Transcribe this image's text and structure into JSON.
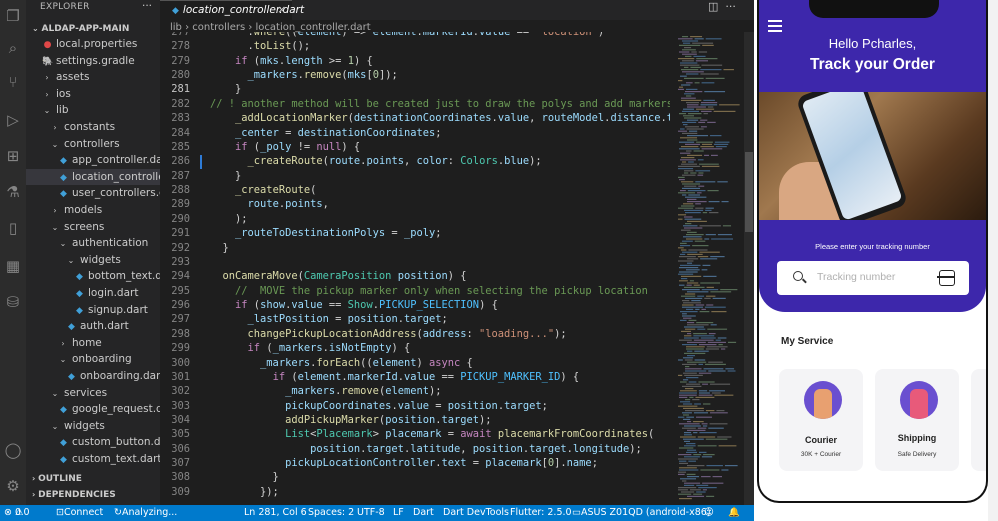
{
  "sidebar": {
    "explorer_title": "EXPLORER",
    "project": "ALDAP-APP-MAIN",
    "tree": [
      {
        "label": "local.properties",
        "depth": 1,
        "icon": "red"
      },
      {
        "label": "settings.gradle",
        "depth": 1,
        "icon": "gradle"
      },
      {
        "label": "assets",
        "depth": 1,
        "folder": "closed"
      },
      {
        "label": "ios",
        "depth": 1,
        "folder": "closed"
      },
      {
        "label": "lib",
        "depth": 1,
        "folder": "open"
      },
      {
        "label": "constants",
        "depth": 2,
        "folder": "closed"
      },
      {
        "label": "controllers",
        "depth": 2,
        "folder": "open"
      },
      {
        "label": "app_controller.dart",
        "depth": 3,
        "icon": "dart"
      },
      {
        "label": "location_controller...",
        "depth": 3,
        "icon": "dart",
        "selected": true
      },
      {
        "label": "user_controllers.dart",
        "depth": 3,
        "icon": "dart"
      },
      {
        "label": "models",
        "depth": 2,
        "folder": "closed"
      },
      {
        "label": "screens",
        "depth": 2,
        "folder": "open"
      },
      {
        "label": "authentication",
        "depth": 3,
        "folder": "open"
      },
      {
        "label": "widgets",
        "depth": 4,
        "folder": "open"
      },
      {
        "label": "bottom_text.dart",
        "depth": 5,
        "icon": "dart"
      },
      {
        "label": "login.dart",
        "depth": 5,
        "icon": "dart"
      },
      {
        "label": "signup.dart",
        "depth": 5,
        "icon": "dart"
      },
      {
        "label": "auth.dart",
        "depth": 4,
        "icon": "dart"
      },
      {
        "label": "home",
        "depth": 3,
        "folder": "closed"
      },
      {
        "label": "onboarding",
        "depth": 3,
        "folder": "open"
      },
      {
        "label": "onboarding.dart",
        "depth": 4,
        "icon": "dart"
      },
      {
        "label": "services",
        "depth": 2,
        "folder": "open"
      },
      {
        "label": "google_request.dart",
        "depth": 3,
        "icon": "dart"
      },
      {
        "label": "widgets",
        "depth": 2,
        "folder": "open"
      },
      {
        "label": "custom_button.dart",
        "depth": 3,
        "icon": "dart"
      },
      {
        "label": "custom_text.dart",
        "depth": 3,
        "icon": "dart"
      }
    ],
    "outline": "OUTLINE",
    "dependencies": "DEPENDENCIES"
  },
  "editor": {
    "tab_label": "location_controller.dart",
    "breadcrumb": "lib › controllers › location_controller.dart",
    "current_line": 281,
    "lines": [
      {
        "n": 277,
        "html": "      .<span class='f'>where</span>((<span class='v'>element</span>) => <span class='v'>element</span>.<span class='v'>markerId</span>.<span class='v'>value</span> == <span class='s'>\"location\"</span>)"
      },
      {
        "n": 278,
        "html": "      .<span class='f'>toList</span>();"
      },
      {
        "n": 279,
        "html": "    <span class='k'>if</span> (<span class='v'>mks</span>.<span class='v'>length</span> >= <span class='n'>1</span>) {"
      },
      {
        "n": 280,
        "html": "      <span class='v'>_markers</span>.<span class='f'>remove</span>(<span class='v'>mks</span>[<span class='n'>0</span>]);"
      },
      {
        "n": 281,
        "html": "    }"
      },
      {
        "n": 282,
        "html": "<span class='c'>// ! another method will be created just to draw the polys and add markers</span>"
      },
      {
        "n": 283,
        "html": "    <span class='f'>_addLocationMarker</span>(<span class='v'>destinationCoordinates</span>.<span class='v'>value</span>, <span class='v'>routeModel</span>.<span class='v'>distance</span>.<span class='v'>text</span>);"
      },
      {
        "n": 284,
        "html": "    <span class='v'>_center</span> = <span class='v'>destinationCoordinates</span>;"
      },
      {
        "n": 285,
        "html": "    <span class='k'>if</span> (<span class='v'>_poly</span> != <span class='k'>null</span>) {"
      },
      {
        "n": 286,
        "html": "      <span class='f'>_createRoute</span>(<span class='v'>route</span>.<span class='v'>points</span>, <span class='v'>color</span>: <span class='t'>Colors</span>.<span class='v'>blue</span>);"
      },
      {
        "n": 287,
        "html": "    }"
      },
      {
        "n": 288,
        "html": "    <span class='f'>_createRoute</span>("
      },
      {
        "n": 289,
        "html": "      <span class='v'>route</span>.<span class='v'>points</span>,"
      },
      {
        "n": 290,
        "html": "    );"
      },
      {
        "n": 291,
        "html": "    <span class='v'>_routeToDestinationPolys</span> = <span class='v'>_poly</span>;"
      },
      {
        "n": 292,
        "html": "  }"
      },
      {
        "n": 293,
        "html": ""
      },
      {
        "n": 294,
        "html": "  <span class='f'>onCameraMove</span>(<span class='t'>CameraPosition</span> <span class='v'>position</span>) {"
      },
      {
        "n": 295,
        "html": "    <span class='c'>//  MOVE the pickup marker only when selecting the pickup location</span>"
      },
      {
        "n": 296,
        "html": "    <span class='k'>if</span> (<span class='v'>show</span>.<span class='v'>value</span> == <span class='t'>Show</span>.<span class='cst'>PICKUP_SELECTION</span>) {"
      },
      {
        "n": 297,
        "html": "      <span class='v'>_lastPosition</span> = <span class='v'>position</span>.<span class='v'>target</span>;"
      },
      {
        "n": 298,
        "html": "      <span class='f'>changePickupLocationAddress</span>(<span class='v'>address</span>: <span class='s'>\"loading...\"</span>);"
      },
      {
        "n": 299,
        "html": "      <span class='k'>if</span> (<span class='v'>_markers</span>.<span class='v'>isNotEmpty</span>) {"
      },
      {
        "n": 300,
        "html": "        <span class='v'>_markers</span>.<span class='f'>forEach</span>((<span class='v'>element</span>) <span class='k'>async</span> {"
      },
      {
        "n": 301,
        "html": "          <span class='k'>if</span> (<span class='v'>element</span>.<span class='v'>markerId</span>.<span class='v'>value</span> == <span class='cst'>PICKUP_MARKER_ID</span>) {"
      },
      {
        "n": 302,
        "html": "            <span class='v'>_markers</span>.<span class='f'>remove</span>(<span class='v'>element</span>);"
      },
      {
        "n": 303,
        "html": "            <span class='v'>pickupCoordinates</span>.<span class='v'>value</span> = <span class='v'>position</span>.<span class='v'>target</span>;"
      },
      {
        "n": 304,
        "html": "            <span class='f'>addPickupMarker</span>(<span class='v'>position</span>.<span class='v'>target</span>);"
      },
      {
        "n": 305,
        "html": "            <span class='t'>List</span>&lt;<span class='t'>Placemark</span>&gt; <span class='v'>placemark</span> = <span class='k'>await</span> <span class='f'>placemarkFromCoordinates</span>("
      },
      {
        "n": 306,
        "html": "                <span class='v'>position</span>.<span class='v'>target</span>.<span class='v'>latitude</span>, <span class='v'>position</span>.<span class='v'>target</span>.<span class='v'>longitude</span>);"
      },
      {
        "n": 307,
        "html": "            <span class='v'>pickupLocationController</span>.<span class='v'>text</span> = <span class='v'>placemark</span>[<span class='n'>0</span>].<span class='v'>name</span>;"
      },
      {
        "n": 308,
        "html": "          }"
      },
      {
        "n": 309,
        "html": "        });"
      }
    ]
  },
  "status": {
    "errors": "0",
    "warnings": "0",
    "connect": "Connect",
    "analyzing": "Analyzing...",
    "position": "Ln 281, Col 6",
    "spaces": "Spaces: 2",
    "encoding": "UTF-8",
    "eol": "LF",
    "language": "Dart",
    "devtools": "Dart DevTools",
    "flutter": "Flutter: 2.5.0",
    "device": "ASUS Z01QD (android-x86)"
  },
  "phone": {
    "greeting": "Hello Pcharles,",
    "headline": "Track your Order",
    "prompt": "Please enter your tracking number",
    "search_placeholder": "Tracking number",
    "section_title": "My Service",
    "cards": [
      {
        "title": "Courier",
        "subtitle": "30K + Courier"
      },
      {
        "title": "Shipping",
        "subtitle": "Safe Delivery"
      }
    ],
    "brand_color": "#3d27ab"
  }
}
